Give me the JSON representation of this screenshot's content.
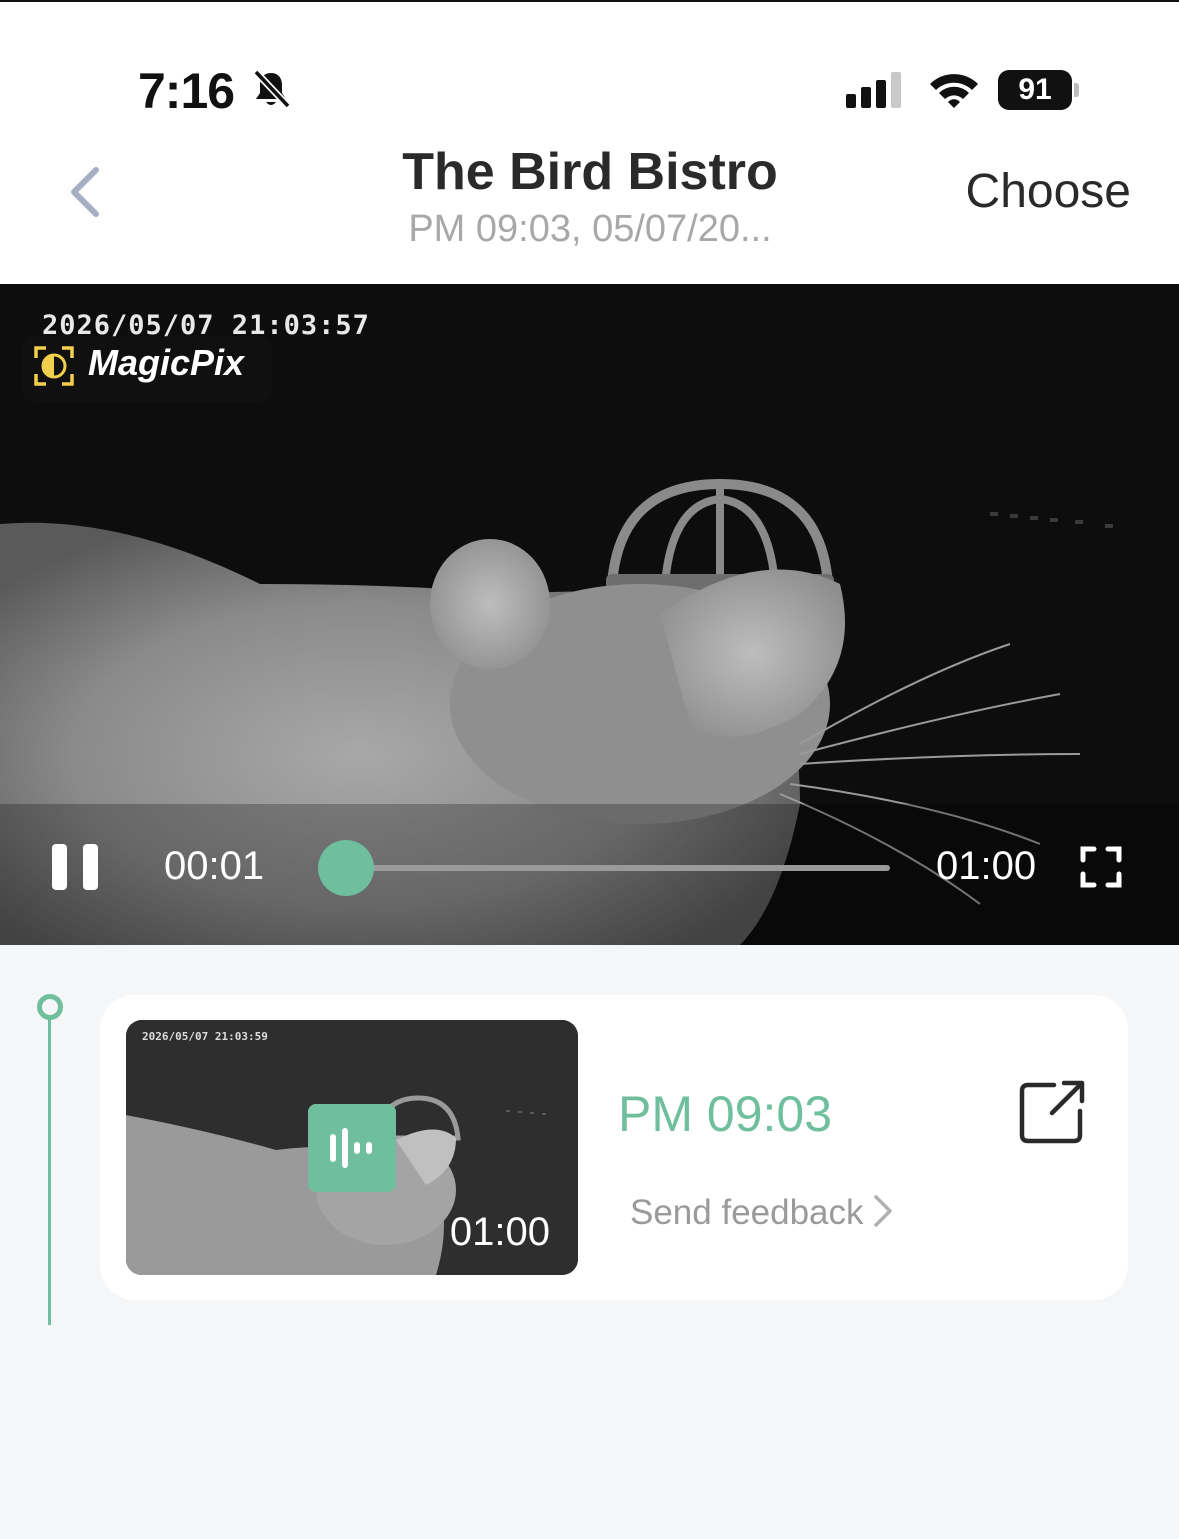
{
  "status_bar": {
    "time": "7:16",
    "battery": "91",
    "icons": [
      "bell-muted-icon",
      "cellular-signal-icon",
      "wifi-icon",
      "battery-icon"
    ]
  },
  "header": {
    "title": "The Bird Bistro",
    "subtitle": "PM 09:03, 05/07/20...",
    "action_label": "Choose",
    "back_icon": "chevron-left-icon"
  },
  "player": {
    "timestamp": "2026/05/07 21:03:57",
    "brand": "MagicPix",
    "current_time": "00:01",
    "duration": "01:00",
    "progress": 0.017,
    "accent_color": "#6fbf9f"
  },
  "events": [
    {
      "thumbnail_timestamp": "2026/05/07 21:03:59",
      "thumbnail_duration": "01:00",
      "time": "PM 09:03",
      "feedback_label": "Send feedback",
      "icons": [
        "audio-wave-icon",
        "share-icon",
        "chevron-right-icon"
      ]
    }
  ]
}
